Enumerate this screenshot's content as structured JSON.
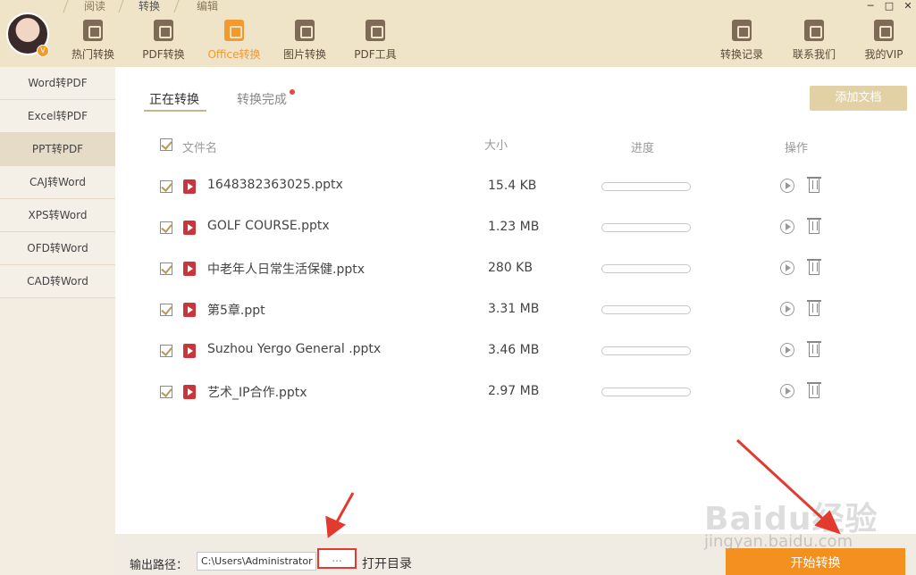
{
  "top_tabs": [
    "阅读",
    "转换",
    "编辑"
  ],
  "nav": [
    {
      "label": "热门转换",
      "icon": "star-doc-icon"
    },
    {
      "label": "PDF转换",
      "icon": "pdf-doc-icon"
    },
    {
      "label": "Office转换",
      "icon": "office-doc-icon",
      "active": true
    },
    {
      "label": "图片转换",
      "icon": "image-doc-icon"
    },
    {
      "label": "PDF工具",
      "icon": "toolbox-icon"
    }
  ],
  "right_nav": [
    {
      "label": "转换记录",
      "icon": "history-icon"
    },
    {
      "label": "联系我们",
      "icon": "headset-icon"
    },
    {
      "label": "我的VIP",
      "icon": "crown-icon"
    }
  ],
  "window_controls": [
    "─",
    "□",
    "✕"
  ],
  "avatar_badge": "V",
  "sidebar": [
    "Word转PDF",
    "Excel转PDF",
    "PPT转PDF",
    "CAJ转Word",
    "XPS转Word",
    "OFD转Word",
    "CAD转Word"
  ],
  "tabs": {
    "converting": "正在转换",
    "done": "转换完成"
  },
  "add_button": "添加文档",
  "columns": {
    "filename": "文件名",
    "size": "大小",
    "progress": "进度",
    "actions": "操作"
  },
  "files": [
    {
      "name": "1648382363025.pptx",
      "size": "15.4 KB",
      "progress": 0
    },
    {
      "name": "GOLF COURSE.pptx",
      "size": "1.23 MB",
      "progress": 0
    },
    {
      "name": "中老年人日常生活保健.pptx",
      "size": "280 KB",
      "progress": 0
    },
    {
      "name": "第5章.ppt",
      "size": "3.31 MB",
      "progress": 0
    },
    {
      "name": "Suzhou Yergo General .pptx",
      "size": "3.46 MB",
      "progress": 0
    },
    {
      "name": "艺术_IP合作.pptx",
      "size": "2.97 MB",
      "progress": 0
    }
  ],
  "bottom": {
    "output_label": "输出路径：",
    "output_path": "C:\\Users\\Administrator",
    "browse": "...",
    "open_dir": "打开目录",
    "start": "开始转换"
  },
  "watermark": {
    "line1": "Baidu经验",
    "line2": "jingyan.baidu.com"
  },
  "colors": {
    "accent": "#f29a2e",
    "header_bg": "#efe3c8",
    "annotation": "#e23a2f"
  }
}
